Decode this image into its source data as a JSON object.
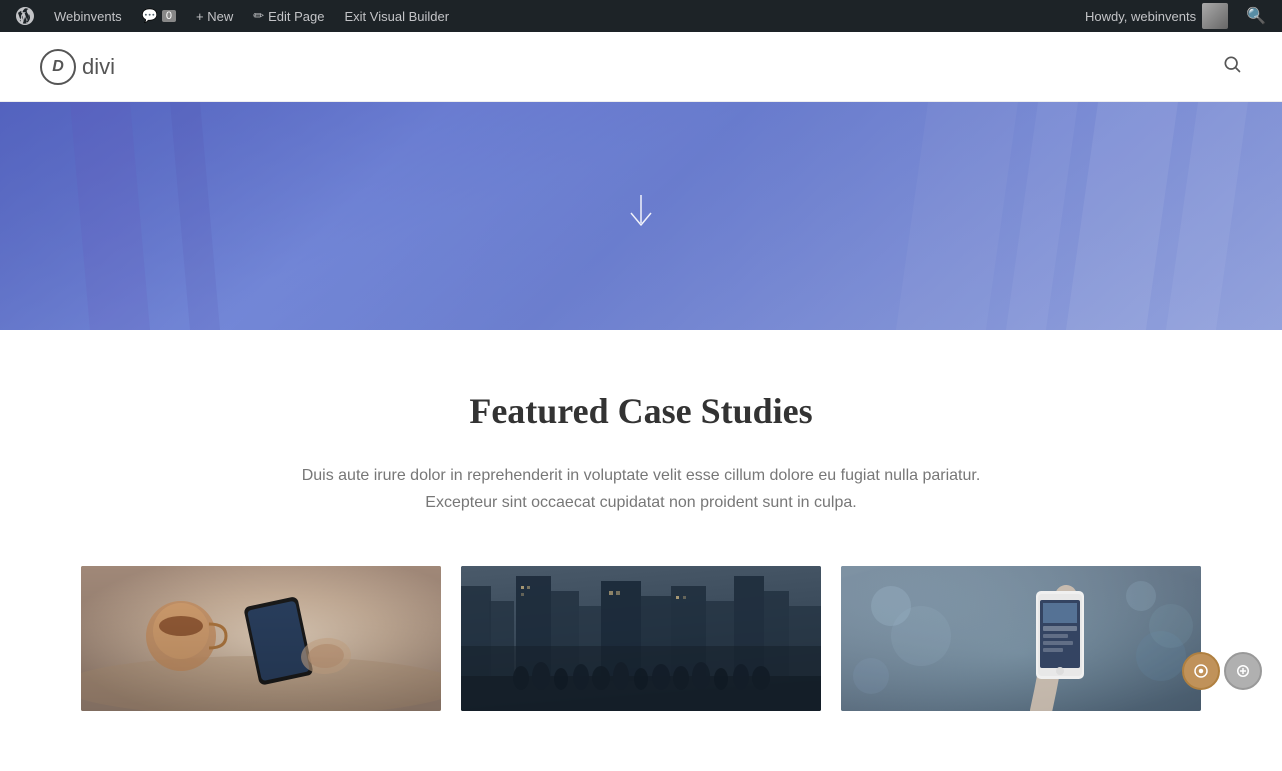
{
  "adminBar": {
    "wpLabel": "WordPress",
    "siteLabel": "Webinvents",
    "comments": {
      "label": "0",
      "icon": "comment-icon"
    },
    "newLabel": "+ New",
    "editPageLabel": "Edit Page",
    "exitBuilderLabel": "Exit Visual Builder",
    "howdy": "Howdy, webinvents",
    "searchIcon": "search-icon"
  },
  "siteHeader": {
    "logoText": "divi",
    "logoLetter": "D",
    "searchIcon": "search-icon"
  },
  "hero": {
    "downArrow": "↓"
  },
  "mainSection": {
    "title": "Featured Case Studies",
    "description": "Duis aute irure dolor in reprehenderit in voluptate velit esse cillum dolore eu fugiat nulla pariatur. Excepteur sint occaecat cupidatat non proident sunt in culpa."
  },
  "cards": [
    {
      "id": "card-1",
      "alt": "Tablet and coffee on desk"
    },
    {
      "id": "card-2",
      "alt": "City crowd street"
    },
    {
      "id": "card-3",
      "alt": "Person holding smartphone"
    }
  ],
  "builderButtons": {
    "toggleLabel": "⚙",
    "editLabel": "✎",
    "colors": {
      "toggle": "#c0925a",
      "edit": "#b0b0b0"
    }
  }
}
